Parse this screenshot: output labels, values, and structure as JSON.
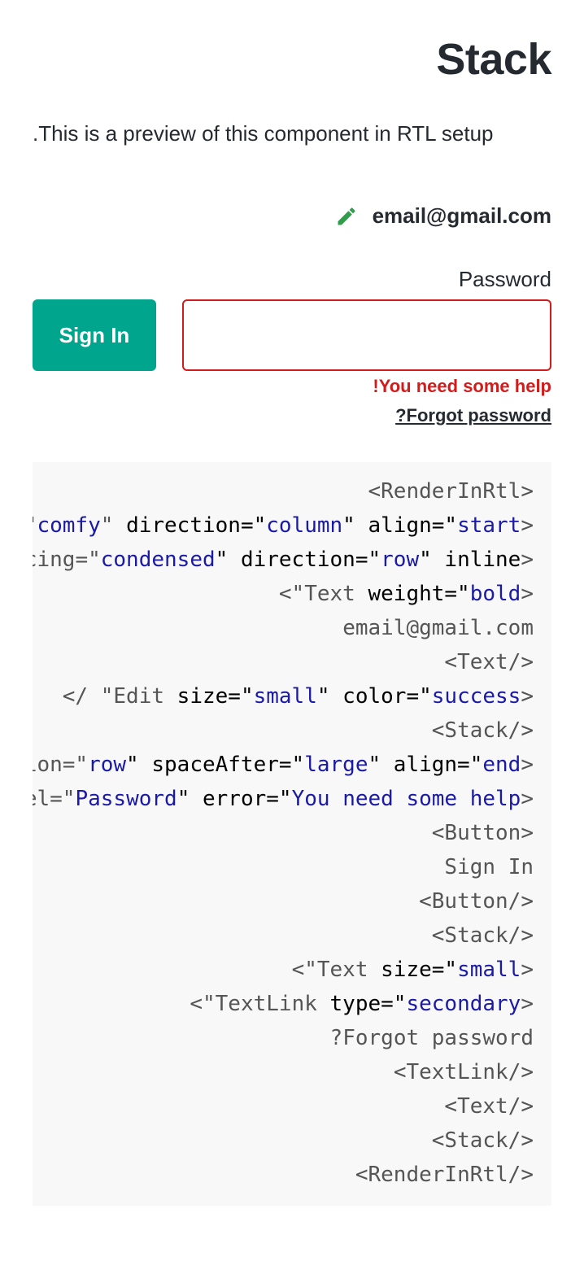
{
  "title": "Stack",
  "description": ".This is a preview of this component in RTL setup",
  "email": "email@gmail.com",
  "icons": {
    "edit": "pencil-icon",
    "edit_color": "#2e9e4a"
  },
  "password_label": "Password",
  "sign_in_label": "Sign In",
  "error_text": "!You need some help",
  "forgot_link": "?Forgot password",
  "colors": {
    "primary": "#00a58e",
    "error": "#d21c1c",
    "text": "#252a31",
    "code_bg": "#f8f8f8",
    "code_value": "#1a1aa6"
  },
  "code": [
    {
      "indent": 0,
      "tokens": [
        {
          "t": "tag",
          "v": "<RenderInRtl>"
        }
      ]
    },
    {
      "indent": 1,
      "tokens": [
        {
          "t": "tag",
          "v": "<Stack spacing=\""
        },
        {
          "t": "val",
          "v": "comfy"
        },
        {
          "t": "tag",
          "v": "\" "
        },
        {
          "t": "attr",
          "v": "direction=\""
        },
        {
          "t": "val",
          "v": "column"
        },
        {
          "t": "attr",
          "v": "\" align=\""
        },
        {
          "t": "val",
          "v": "start"
        },
        {
          "t": "tag",
          "v": ">"
        }
      ]
    },
    {
      "indent": 2,
      "tokens": [
        {
          "t": "tag",
          "v": "<Stack spacing=\""
        },
        {
          "t": "val",
          "v": "condensed"
        },
        {
          "t": "attr",
          "v": "\" direction=\""
        },
        {
          "t": "val",
          "v": "row"
        },
        {
          "t": "attr",
          "v": "\" inline"
        },
        {
          "t": "tag",
          "v": ">"
        }
      ]
    },
    {
      "indent": 3,
      "tokens": [
        {
          "t": "tag",
          "v": "<\"Text "
        },
        {
          "t": "attr",
          "v": "weight=\""
        },
        {
          "t": "val",
          "v": "bold"
        },
        {
          "t": "tag",
          "v": ">"
        }
      ]
    },
    {
      "indent": 4,
      "tokens": [
        {
          "t": "tag",
          "v": "email@gmail.com"
        }
      ]
    },
    {
      "indent": 3,
      "tokens": [
        {
          "t": "tag",
          "v": "<Text/>"
        }
      ]
    },
    {
      "indent": 3,
      "tokens": [
        {
          "t": "tag",
          "v": "</ \"Edit "
        },
        {
          "t": "attr",
          "v": "size=\""
        },
        {
          "t": "val",
          "v": "small"
        },
        {
          "t": "attr",
          "v": "\" color=\""
        },
        {
          "t": "val",
          "v": "success"
        },
        {
          "t": "tag",
          "v": ">"
        }
      ]
    },
    {
      "indent": 2,
      "tokens": [
        {
          "t": "tag",
          "v": "<Stack/>"
        }
      ]
    },
    {
      "indent": 2,
      "tokens": [
        {
          "t": "tag",
          "v": "<Stack direction=\""
        },
        {
          "t": "val",
          "v": "row"
        },
        {
          "t": "attr",
          "v": "\" spaceAfter=\""
        },
        {
          "t": "val",
          "v": "large"
        },
        {
          "t": "attr",
          "v": "\" align=\""
        },
        {
          "t": "val",
          "v": "end"
        },
        {
          "t": "tag",
          "v": ">"
        }
      ]
    },
    {
      "indent": 3,
      "tokens": [
        {
          "t": "tag",
          "v": "<InputField label=\""
        },
        {
          "t": "val",
          "v": "Password"
        },
        {
          "t": "attr",
          "v": "\" error=\""
        },
        {
          "t": "val",
          "v": "You need some help"
        },
        {
          "t": "tag",
          "v": ">"
        }
      ]
    },
    {
      "indent": 3,
      "tokens": [
        {
          "t": "tag",
          "v": "<Button>"
        }
      ]
    },
    {
      "indent": 4,
      "tokens": [
        {
          "t": "tag",
          "v": "Sign In"
        }
      ]
    },
    {
      "indent": 3,
      "tokens": [
        {
          "t": "tag",
          "v": "<Button/>"
        }
      ]
    },
    {
      "indent": 2,
      "tokens": [
        {
          "t": "tag",
          "v": "<Stack/>"
        }
      ]
    },
    {
      "indent": 2,
      "tokens": [
        {
          "t": "tag",
          "v": "<\"Text "
        },
        {
          "t": "attr",
          "v": "size=\""
        },
        {
          "t": "val",
          "v": "small"
        },
        {
          "t": "tag",
          "v": ">"
        }
      ]
    },
    {
      "indent": 3,
      "tokens": [
        {
          "t": "tag",
          "v": "<\"TextLink "
        },
        {
          "t": "attr",
          "v": "type=\""
        },
        {
          "t": "val",
          "v": "secondary"
        },
        {
          "t": "tag",
          "v": ">"
        }
      ]
    },
    {
      "indent": 4,
      "tokens": [
        {
          "t": "tag",
          "v": "?Forgot password"
        }
      ]
    },
    {
      "indent": 3,
      "tokens": [
        {
          "t": "tag",
          "v": "<TextLink/>"
        }
      ]
    },
    {
      "indent": 2,
      "tokens": [
        {
          "t": "tag",
          "v": "<Text/>"
        }
      ]
    },
    {
      "indent": 1,
      "tokens": [
        {
          "t": "tag",
          "v": "<Stack/>"
        }
      ]
    },
    {
      "indent": 0,
      "tokens": [
        {
          "t": "tag",
          "v": "<RenderInRtl/>"
        }
      ]
    }
  ]
}
